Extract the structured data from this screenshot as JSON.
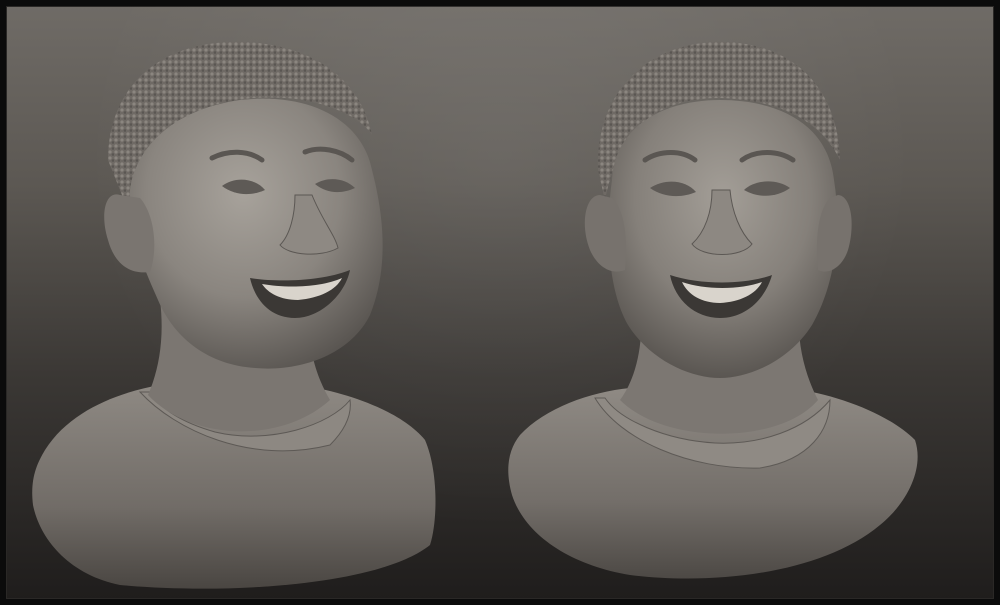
{
  "scene": {
    "subject": "two-3d-sculpted-busts",
    "palette": {
      "clay_light": "#a29d96",
      "clay_mid": "#7f7a74",
      "clay_dark": "#4a4642",
      "teeth": "#d9d4cc",
      "background_top": "#6f6b66",
      "background_bottom": "#1f1d1c",
      "frame": "#0b0b0b"
    }
  }
}
